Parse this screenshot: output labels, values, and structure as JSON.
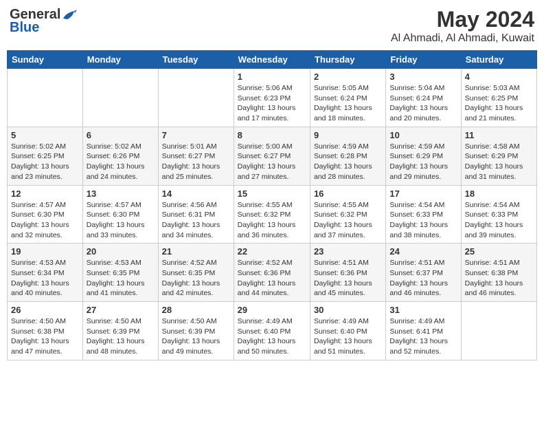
{
  "logo": {
    "general": "General",
    "blue": "Blue"
  },
  "title": {
    "month": "May 2024",
    "location": "Al Ahmadi, Al Ahmadi, Kuwait"
  },
  "headers": [
    "Sunday",
    "Monday",
    "Tuesday",
    "Wednesday",
    "Thursday",
    "Friday",
    "Saturday"
  ],
  "weeks": [
    [
      {
        "day": "",
        "info": ""
      },
      {
        "day": "",
        "info": ""
      },
      {
        "day": "",
        "info": ""
      },
      {
        "day": "1",
        "info": "Sunrise: 5:06 AM\nSunset: 6:23 PM\nDaylight: 13 hours\nand 17 minutes."
      },
      {
        "day": "2",
        "info": "Sunrise: 5:05 AM\nSunset: 6:24 PM\nDaylight: 13 hours\nand 18 minutes."
      },
      {
        "day": "3",
        "info": "Sunrise: 5:04 AM\nSunset: 6:24 PM\nDaylight: 13 hours\nand 20 minutes."
      },
      {
        "day": "4",
        "info": "Sunrise: 5:03 AM\nSunset: 6:25 PM\nDaylight: 13 hours\nand 21 minutes."
      }
    ],
    [
      {
        "day": "5",
        "info": "Sunrise: 5:02 AM\nSunset: 6:25 PM\nDaylight: 13 hours\nand 23 minutes."
      },
      {
        "day": "6",
        "info": "Sunrise: 5:02 AM\nSunset: 6:26 PM\nDaylight: 13 hours\nand 24 minutes."
      },
      {
        "day": "7",
        "info": "Sunrise: 5:01 AM\nSunset: 6:27 PM\nDaylight: 13 hours\nand 25 minutes."
      },
      {
        "day": "8",
        "info": "Sunrise: 5:00 AM\nSunset: 6:27 PM\nDaylight: 13 hours\nand 27 minutes."
      },
      {
        "day": "9",
        "info": "Sunrise: 4:59 AM\nSunset: 6:28 PM\nDaylight: 13 hours\nand 28 minutes."
      },
      {
        "day": "10",
        "info": "Sunrise: 4:59 AM\nSunset: 6:29 PM\nDaylight: 13 hours\nand 29 minutes."
      },
      {
        "day": "11",
        "info": "Sunrise: 4:58 AM\nSunset: 6:29 PM\nDaylight: 13 hours\nand 31 minutes."
      }
    ],
    [
      {
        "day": "12",
        "info": "Sunrise: 4:57 AM\nSunset: 6:30 PM\nDaylight: 13 hours\nand 32 minutes."
      },
      {
        "day": "13",
        "info": "Sunrise: 4:57 AM\nSunset: 6:30 PM\nDaylight: 13 hours\nand 33 minutes."
      },
      {
        "day": "14",
        "info": "Sunrise: 4:56 AM\nSunset: 6:31 PM\nDaylight: 13 hours\nand 34 minutes."
      },
      {
        "day": "15",
        "info": "Sunrise: 4:55 AM\nSunset: 6:32 PM\nDaylight: 13 hours\nand 36 minutes."
      },
      {
        "day": "16",
        "info": "Sunrise: 4:55 AM\nSunset: 6:32 PM\nDaylight: 13 hours\nand 37 minutes."
      },
      {
        "day": "17",
        "info": "Sunrise: 4:54 AM\nSunset: 6:33 PM\nDaylight: 13 hours\nand 38 minutes."
      },
      {
        "day": "18",
        "info": "Sunrise: 4:54 AM\nSunset: 6:33 PM\nDaylight: 13 hours\nand 39 minutes."
      }
    ],
    [
      {
        "day": "19",
        "info": "Sunrise: 4:53 AM\nSunset: 6:34 PM\nDaylight: 13 hours\nand 40 minutes."
      },
      {
        "day": "20",
        "info": "Sunrise: 4:53 AM\nSunset: 6:35 PM\nDaylight: 13 hours\nand 41 minutes."
      },
      {
        "day": "21",
        "info": "Sunrise: 4:52 AM\nSunset: 6:35 PM\nDaylight: 13 hours\nand 42 minutes."
      },
      {
        "day": "22",
        "info": "Sunrise: 4:52 AM\nSunset: 6:36 PM\nDaylight: 13 hours\nand 44 minutes."
      },
      {
        "day": "23",
        "info": "Sunrise: 4:51 AM\nSunset: 6:36 PM\nDaylight: 13 hours\nand 45 minutes."
      },
      {
        "day": "24",
        "info": "Sunrise: 4:51 AM\nSunset: 6:37 PM\nDaylight: 13 hours\nand 46 minutes."
      },
      {
        "day": "25",
        "info": "Sunrise: 4:51 AM\nSunset: 6:38 PM\nDaylight: 13 hours\nand 46 minutes."
      }
    ],
    [
      {
        "day": "26",
        "info": "Sunrise: 4:50 AM\nSunset: 6:38 PM\nDaylight: 13 hours\nand 47 minutes."
      },
      {
        "day": "27",
        "info": "Sunrise: 4:50 AM\nSunset: 6:39 PM\nDaylight: 13 hours\nand 48 minutes."
      },
      {
        "day": "28",
        "info": "Sunrise: 4:50 AM\nSunset: 6:39 PM\nDaylight: 13 hours\nand 49 minutes."
      },
      {
        "day": "29",
        "info": "Sunrise: 4:49 AM\nSunset: 6:40 PM\nDaylight: 13 hours\nand 50 minutes."
      },
      {
        "day": "30",
        "info": "Sunrise: 4:49 AM\nSunset: 6:40 PM\nDaylight: 13 hours\nand 51 minutes."
      },
      {
        "day": "31",
        "info": "Sunrise: 4:49 AM\nSunset: 6:41 PM\nDaylight: 13 hours\nand 52 minutes."
      },
      {
        "day": "",
        "info": ""
      }
    ]
  ]
}
